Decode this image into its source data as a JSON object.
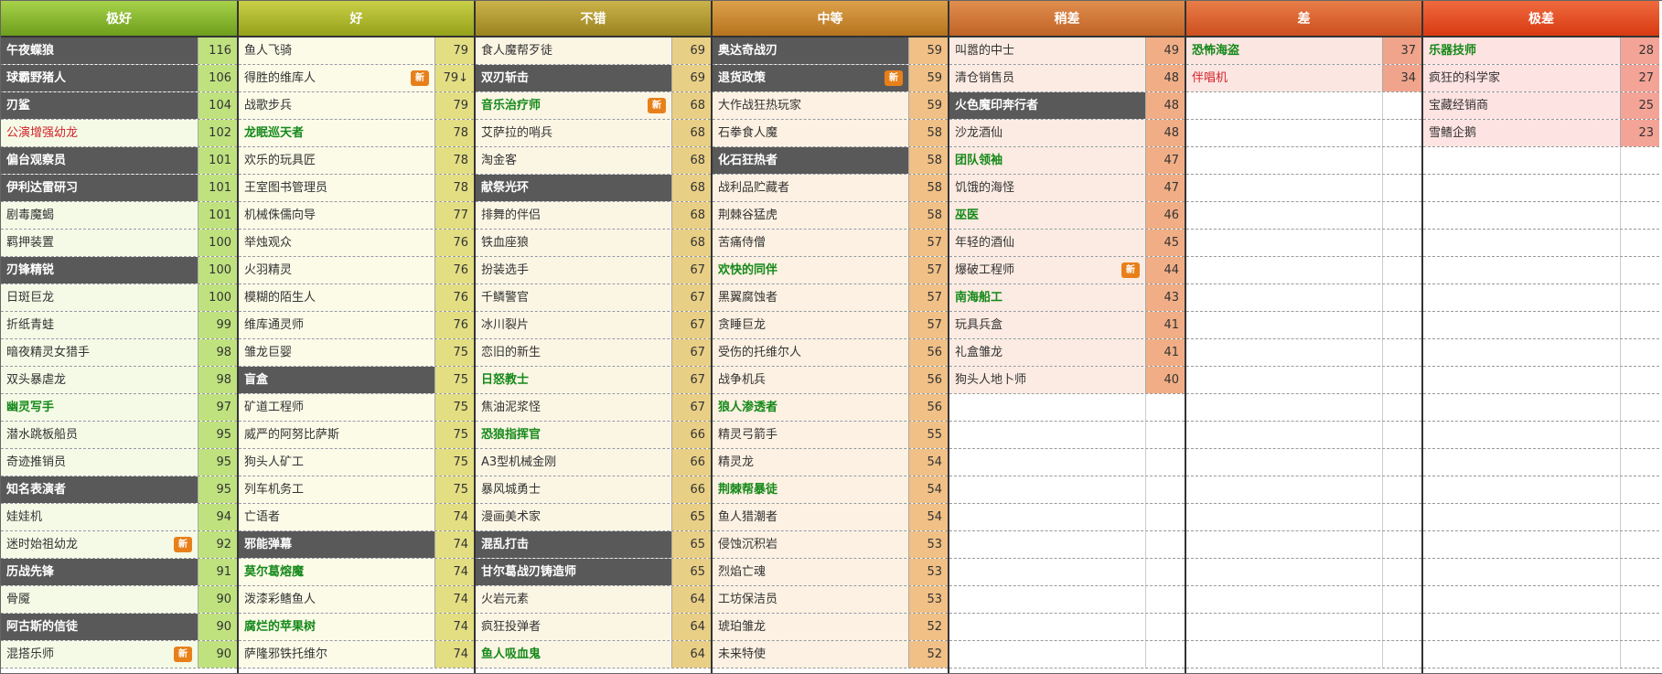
{
  "badge_text": "新",
  "tiers": [
    {
      "title": "极好",
      "cards": [
        {
          "name": "午夜蝶狼",
          "score": "116",
          "style": "dark"
        },
        {
          "name": "球霸野猪人",
          "score": "106",
          "style": "dark"
        },
        {
          "name": "刃鲨",
          "score": "104",
          "style": "dark"
        },
        {
          "name": "公演增强幼龙",
          "score": "102",
          "style": "red"
        },
        {
          "name": "偏台观察员",
          "score": "101",
          "style": "dark"
        },
        {
          "name": "伊利达雷研习",
          "score": "101",
          "style": "dark"
        },
        {
          "name": "剧毒魔蝎",
          "score": "101",
          "style": ""
        },
        {
          "name": "羁押装置",
          "score": "100",
          "style": ""
        },
        {
          "name": "刃锋精锐",
          "score": "100",
          "style": "dark"
        },
        {
          "name": "日斑巨龙",
          "score": "100",
          "style": ""
        },
        {
          "name": "折纸青蛙",
          "score": "99",
          "style": ""
        },
        {
          "name": "暗夜精灵女猎手",
          "score": "98",
          "style": ""
        },
        {
          "name": "双头暴虐龙",
          "score": "98",
          "style": ""
        },
        {
          "name": "幽灵写手",
          "score": "97",
          "style": "green"
        },
        {
          "name": "潜水跳板船员",
          "score": "95",
          "style": ""
        },
        {
          "name": "奇迹推销员",
          "score": "95",
          "style": ""
        },
        {
          "name": "知名表演者",
          "score": "95",
          "style": "dark"
        },
        {
          "name": "娃娃机",
          "score": "94",
          "style": ""
        },
        {
          "name": "迷时始祖幼龙",
          "score": "92",
          "style": "",
          "badge": true
        },
        {
          "name": "历战先锋",
          "score": "91",
          "style": "dark"
        },
        {
          "name": "骨魇",
          "score": "90",
          "style": ""
        },
        {
          "name": "阿古斯的信徒",
          "score": "90",
          "style": "dark"
        },
        {
          "name": "混搭乐师",
          "score": "90",
          "style": "",
          "badge": true
        }
      ]
    },
    {
      "title": "好",
      "cards": [
        {
          "name": "鱼人飞骑",
          "score": "79",
          "style": ""
        },
        {
          "name": "得胜的维库人",
          "score": "79↓",
          "style": "",
          "badge": true
        },
        {
          "name": "战歌步兵",
          "score": "79",
          "style": ""
        },
        {
          "name": "龙眠巡天者",
          "score": "78",
          "style": "green"
        },
        {
          "name": "欢乐的玩具匠",
          "score": "78",
          "style": ""
        },
        {
          "name": "王室图书管理员",
          "score": "78",
          "style": ""
        },
        {
          "name": "机械侏儒向导",
          "score": "77",
          "style": ""
        },
        {
          "name": "举烛观众",
          "score": "76",
          "style": ""
        },
        {
          "name": "火羽精灵",
          "score": "76",
          "style": ""
        },
        {
          "name": "模糊的陌生人",
          "score": "76",
          "style": ""
        },
        {
          "name": "维库通灵师",
          "score": "76",
          "style": ""
        },
        {
          "name": "雏龙巨婴",
          "score": "75",
          "style": ""
        },
        {
          "name": "盲盒",
          "score": "75",
          "style": "dark"
        },
        {
          "name": "矿道工程师",
          "score": "75",
          "style": ""
        },
        {
          "name": "威严的阿努比萨斯",
          "score": "75",
          "style": ""
        },
        {
          "name": "狗头人矿工",
          "score": "75",
          "style": ""
        },
        {
          "name": "列车机务工",
          "score": "75",
          "style": ""
        },
        {
          "name": "亡语者",
          "score": "74",
          "style": ""
        },
        {
          "name": "邪能弹幕",
          "score": "74",
          "style": "dark"
        },
        {
          "name": "莫尔葛熔魔",
          "score": "74",
          "style": "green"
        },
        {
          "name": "泼漆彩鳍鱼人",
          "score": "74",
          "style": ""
        },
        {
          "name": "腐烂的苹果树",
          "score": "74",
          "style": "green"
        },
        {
          "name": "萨隆邪铁托维尔",
          "score": "74",
          "style": ""
        }
      ]
    },
    {
      "title": "不错",
      "cards": [
        {
          "name": "食人魔帮歹徒",
          "score": "69",
          "style": ""
        },
        {
          "name": "双刃斩击",
          "score": "69",
          "style": "dark"
        },
        {
          "name": "音乐治疗师",
          "score": "68",
          "style": "green",
          "badge": true
        },
        {
          "name": "艾萨拉的哨兵",
          "score": "68",
          "style": ""
        },
        {
          "name": "淘金客",
          "score": "68",
          "style": ""
        },
        {
          "name": "献祭光环",
          "score": "68",
          "style": "dark"
        },
        {
          "name": "排舞的伴侣",
          "score": "68",
          "style": ""
        },
        {
          "name": "铁血座狼",
          "score": "68",
          "style": ""
        },
        {
          "name": "扮装选手",
          "score": "67",
          "style": ""
        },
        {
          "name": "千鳞警官",
          "score": "67",
          "style": ""
        },
        {
          "name": "冰川裂片",
          "score": "67",
          "style": ""
        },
        {
          "name": "恋旧的新生",
          "score": "67",
          "style": ""
        },
        {
          "name": "日怒教士",
          "score": "67",
          "style": "green"
        },
        {
          "name": "焦油泥浆怪",
          "score": "67",
          "style": ""
        },
        {
          "name": "恐狼指挥官",
          "score": "66",
          "style": "green"
        },
        {
          "name": "A3型机械金刚",
          "score": "66",
          "style": ""
        },
        {
          "name": "暴风城勇士",
          "score": "66",
          "style": ""
        },
        {
          "name": "漫画美术家",
          "score": "65",
          "style": ""
        },
        {
          "name": "混乱打击",
          "score": "65",
          "style": "dark"
        },
        {
          "name": "甘尔葛战刃铸造师",
          "score": "65",
          "style": "dark"
        },
        {
          "name": "火岩元素",
          "score": "64",
          "style": ""
        },
        {
          "name": "疯狂投弹者",
          "score": "64",
          "style": ""
        },
        {
          "name": "鱼人吸血鬼",
          "score": "64",
          "style": "green"
        }
      ]
    },
    {
      "title": "中等",
      "cards": [
        {
          "name": "奥达奇战刃",
          "score": "59",
          "style": "dark"
        },
        {
          "name": "退货政策",
          "score": "59",
          "style": "dark",
          "badge": true
        },
        {
          "name": "大作战狂热玩家",
          "score": "59",
          "style": ""
        },
        {
          "name": "石拳食人魔",
          "score": "58",
          "style": ""
        },
        {
          "name": "化石狂热者",
          "score": "58",
          "style": "dark"
        },
        {
          "name": "战利品贮藏者",
          "score": "58",
          "style": ""
        },
        {
          "name": "荆棘谷猛虎",
          "score": "58",
          "style": ""
        },
        {
          "name": "苦痛侍僧",
          "score": "57",
          "style": ""
        },
        {
          "name": "欢快的同伴",
          "score": "57",
          "style": "green"
        },
        {
          "name": "黑翼腐蚀者",
          "score": "57",
          "style": ""
        },
        {
          "name": "贪睡巨龙",
          "score": "57",
          "style": ""
        },
        {
          "name": "受伤的托维尔人",
          "score": "56",
          "style": ""
        },
        {
          "name": "战争机兵",
          "score": "56",
          "style": ""
        },
        {
          "name": "狼人渗透者",
          "score": "56",
          "style": "green"
        },
        {
          "name": "精灵弓箭手",
          "score": "55",
          "style": ""
        },
        {
          "name": "精灵龙",
          "score": "54",
          "style": ""
        },
        {
          "name": "荆棘帮暴徒",
          "score": "54",
          "style": "green"
        },
        {
          "name": "鱼人猎潮者",
          "score": "54",
          "style": ""
        },
        {
          "name": "侵蚀沉积岩",
          "score": "53",
          "style": ""
        },
        {
          "name": "烈焰亡魂",
          "score": "53",
          "style": ""
        },
        {
          "name": "工坊保洁员",
          "score": "53",
          "style": ""
        },
        {
          "name": "琥珀雏龙",
          "score": "52",
          "style": ""
        },
        {
          "name": "未来特使",
          "score": "52",
          "style": ""
        }
      ]
    },
    {
      "title": "稍差",
      "cards": [
        {
          "name": "叫嚣的中士",
          "score": "49",
          "style": ""
        },
        {
          "name": "清仓销售员",
          "score": "48",
          "style": ""
        },
        {
          "name": "火色魔印奔行者",
          "score": "48",
          "style": "dark"
        },
        {
          "name": "沙龙酒仙",
          "score": "48",
          "style": ""
        },
        {
          "name": "团队领袖",
          "score": "47",
          "style": "green"
        },
        {
          "name": "饥饿的海怪",
          "score": "47",
          "style": ""
        },
        {
          "name": "巫医",
          "score": "46",
          "style": "green"
        },
        {
          "name": "年轻的酒仙",
          "score": "45",
          "style": ""
        },
        {
          "name": "爆破工程师",
          "score": "44",
          "style": "",
          "badge": true
        },
        {
          "name": "南海船工",
          "score": "43",
          "style": "green"
        },
        {
          "name": "玩具兵盒",
          "score": "41",
          "style": ""
        },
        {
          "name": "礼盒雏龙",
          "score": "41",
          "style": ""
        },
        {
          "name": "狗头人地卜师",
          "score": "40",
          "style": ""
        }
      ]
    },
    {
      "title": "差",
      "cards": [
        {
          "name": "恐怖海盗",
          "score": "37",
          "style": "green"
        },
        {
          "name": "伴唱机",
          "score": "34",
          "style": "red"
        }
      ]
    },
    {
      "title": "极差",
      "cards": [
        {
          "name": "乐器技师",
          "score": "28",
          "style": "green"
        },
        {
          "name": "疯狂的科学家",
          "score": "27",
          "style": ""
        },
        {
          "name": "宝藏经销商",
          "score": "25",
          "style": ""
        },
        {
          "name": "雪鳍企鹅",
          "score": "23",
          "style": ""
        }
      ]
    }
  ]
}
